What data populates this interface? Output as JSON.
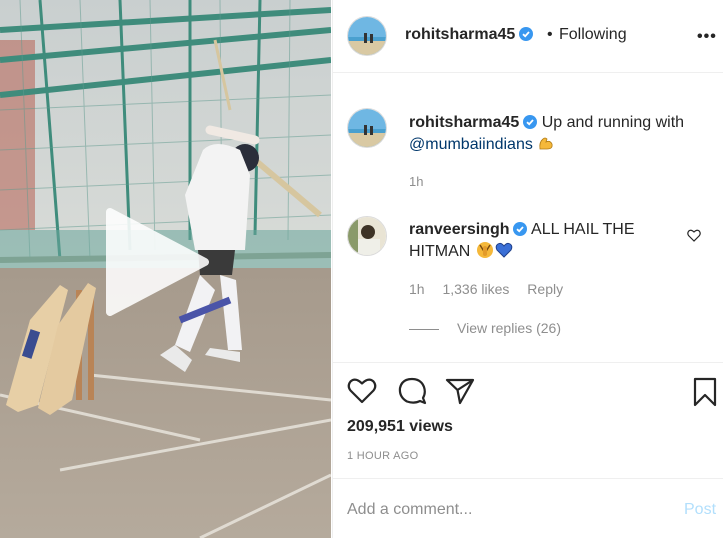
{
  "header": {
    "username": "rohitsharma45",
    "separator": "•",
    "follow_status": "Following",
    "more_label": "•••"
  },
  "caption": {
    "username": "rohitsharma45",
    "text": "Up and running with",
    "mention": "@mumbaiindians",
    "emoji_icon": "flexed-biceps-icon",
    "time": "1h"
  },
  "comment": {
    "username": "ranveersingh",
    "text": "ALL HAIL THE HITMAN",
    "emoji_icons": [
      "praying-face-icon",
      "blue-heart-icon"
    ],
    "time": "1h",
    "likes": "1,336 likes",
    "reply": "Reply",
    "view_replies": "View replies (26)"
  },
  "stats": {
    "views": "209,951 views",
    "posted": "1 HOUR AGO"
  },
  "composer": {
    "placeholder": "Add a comment...",
    "post_label": "Post"
  },
  "colors": {
    "verified": "#3897f0",
    "mention": "#00376b",
    "muted": "#8e8e8e",
    "post_disabled": "#b2dffc"
  }
}
